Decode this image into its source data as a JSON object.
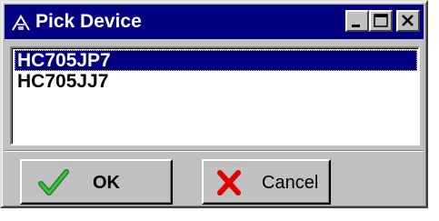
{
  "window": {
    "title": "Pick Device",
    "title_icon": "chip-probe-icon",
    "controls": [
      "minimize-icon",
      "maximize-icon",
      "close-icon"
    ]
  },
  "device_list": {
    "items": [
      "HC705JP7",
      "HC705JJ7"
    ],
    "selected": "HC705JP7"
  },
  "buttons": {
    "ok_label": "OK",
    "ok_icon": "checkmark-icon",
    "cancel_label": "Cancel",
    "cancel_icon": "red-x-icon"
  },
  "colors": {
    "titlebar": "#000080",
    "face": "#c0c0c0",
    "check": "#2a9a2a",
    "cancel_x": "#e00000"
  }
}
